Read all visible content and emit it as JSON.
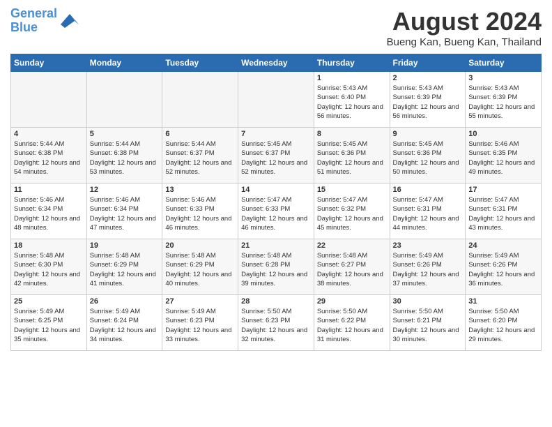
{
  "header": {
    "logo_line1": "General",
    "logo_line2": "Blue",
    "month_title": "August 2024",
    "location": "Bueng Kan, Bueng Kan, Thailand"
  },
  "weekdays": [
    "Sunday",
    "Monday",
    "Tuesday",
    "Wednesday",
    "Thursday",
    "Friday",
    "Saturday"
  ],
  "weeks": [
    {
      "days": [
        {
          "date": "",
          "empty": true
        },
        {
          "date": "",
          "empty": true
        },
        {
          "date": "",
          "empty": true
        },
        {
          "date": "",
          "empty": true
        },
        {
          "date": "1",
          "sunrise": "5:43 AM",
          "sunset": "6:40 PM",
          "daylight": "12 hours and 56 minutes."
        },
        {
          "date": "2",
          "sunrise": "5:43 AM",
          "sunset": "6:39 PM",
          "daylight": "12 hours and 56 minutes."
        },
        {
          "date": "3",
          "sunrise": "5:43 AM",
          "sunset": "6:39 PM",
          "daylight": "12 hours and 55 minutes."
        }
      ]
    },
    {
      "days": [
        {
          "date": "4",
          "sunrise": "5:44 AM",
          "sunset": "6:38 PM",
          "daylight": "12 hours and 54 minutes."
        },
        {
          "date": "5",
          "sunrise": "5:44 AM",
          "sunset": "6:38 PM",
          "daylight": "12 hours and 53 minutes."
        },
        {
          "date": "6",
          "sunrise": "5:44 AM",
          "sunset": "6:37 PM",
          "daylight": "12 hours and 52 minutes."
        },
        {
          "date": "7",
          "sunrise": "5:45 AM",
          "sunset": "6:37 PM",
          "daylight": "12 hours and 52 minutes."
        },
        {
          "date": "8",
          "sunrise": "5:45 AM",
          "sunset": "6:36 PM",
          "daylight": "12 hours and 51 minutes."
        },
        {
          "date": "9",
          "sunrise": "5:45 AM",
          "sunset": "6:36 PM",
          "daylight": "12 hours and 50 minutes."
        },
        {
          "date": "10",
          "sunrise": "5:46 AM",
          "sunset": "6:35 PM",
          "daylight": "12 hours and 49 minutes."
        }
      ]
    },
    {
      "days": [
        {
          "date": "11",
          "sunrise": "5:46 AM",
          "sunset": "6:34 PM",
          "daylight": "12 hours and 48 minutes."
        },
        {
          "date": "12",
          "sunrise": "5:46 AM",
          "sunset": "6:34 PM",
          "daylight": "12 hours and 47 minutes."
        },
        {
          "date": "13",
          "sunrise": "5:46 AM",
          "sunset": "6:33 PM",
          "daylight": "12 hours and 46 minutes."
        },
        {
          "date": "14",
          "sunrise": "5:47 AM",
          "sunset": "6:33 PM",
          "daylight": "12 hours and 46 minutes."
        },
        {
          "date": "15",
          "sunrise": "5:47 AM",
          "sunset": "6:32 PM",
          "daylight": "12 hours and 45 minutes."
        },
        {
          "date": "16",
          "sunrise": "5:47 AM",
          "sunset": "6:31 PM",
          "daylight": "12 hours and 44 minutes."
        },
        {
          "date": "17",
          "sunrise": "5:47 AM",
          "sunset": "6:31 PM",
          "daylight": "12 hours and 43 minutes."
        }
      ]
    },
    {
      "days": [
        {
          "date": "18",
          "sunrise": "5:48 AM",
          "sunset": "6:30 PM",
          "daylight": "12 hours and 42 minutes."
        },
        {
          "date": "19",
          "sunrise": "5:48 AM",
          "sunset": "6:29 PM",
          "daylight": "12 hours and 41 minutes."
        },
        {
          "date": "20",
          "sunrise": "5:48 AM",
          "sunset": "6:29 PM",
          "daylight": "12 hours and 40 minutes."
        },
        {
          "date": "21",
          "sunrise": "5:48 AM",
          "sunset": "6:28 PM",
          "daylight": "12 hours and 39 minutes."
        },
        {
          "date": "22",
          "sunrise": "5:48 AM",
          "sunset": "6:27 PM",
          "daylight": "12 hours and 38 minutes."
        },
        {
          "date": "23",
          "sunrise": "5:49 AM",
          "sunset": "6:26 PM",
          "daylight": "12 hours and 37 minutes."
        },
        {
          "date": "24",
          "sunrise": "5:49 AM",
          "sunset": "6:26 PM",
          "daylight": "12 hours and 36 minutes."
        }
      ]
    },
    {
      "days": [
        {
          "date": "25",
          "sunrise": "5:49 AM",
          "sunset": "6:25 PM",
          "daylight": "12 hours and 35 minutes."
        },
        {
          "date": "26",
          "sunrise": "5:49 AM",
          "sunset": "6:24 PM",
          "daylight": "12 hours and 34 minutes."
        },
        {
          "date": "27",
          "sunrise": "5:49 AM",
          "sunset": "6:23 PM",
          "daylight": "12 hours and 33 minutes."
        },
        {
          "date": "28",
          "sunrise": "5:50 AM",
          "sunset": "6:23 PM",
          "daylight": "12 hours and 32 minutes."
        },
        {
          "date": "29",
          "sunrise": "5:50 AM",
          "sunset": "6:22 PM",
          "daylight": "12 hours and 31 minutes."
        },
        {
          "date": "30",
          "sunrise": "5:50 AM",
          "sunset": "6:21 PM",
          "daylight": "12 hours and 30 minutes."
        },
        {
          "date": "31",
          "sunrise": "5:50 AM",
          "sunset": "6:20 PM",
          "daylight": "12 hours and 29 minutes."
        }
      ]
    }
  ],
  "labels": {
    "sunrise": "Sunrise:",
    "sunset": "Sunset:",
    "daylight": "Daylight:"
  }
}
